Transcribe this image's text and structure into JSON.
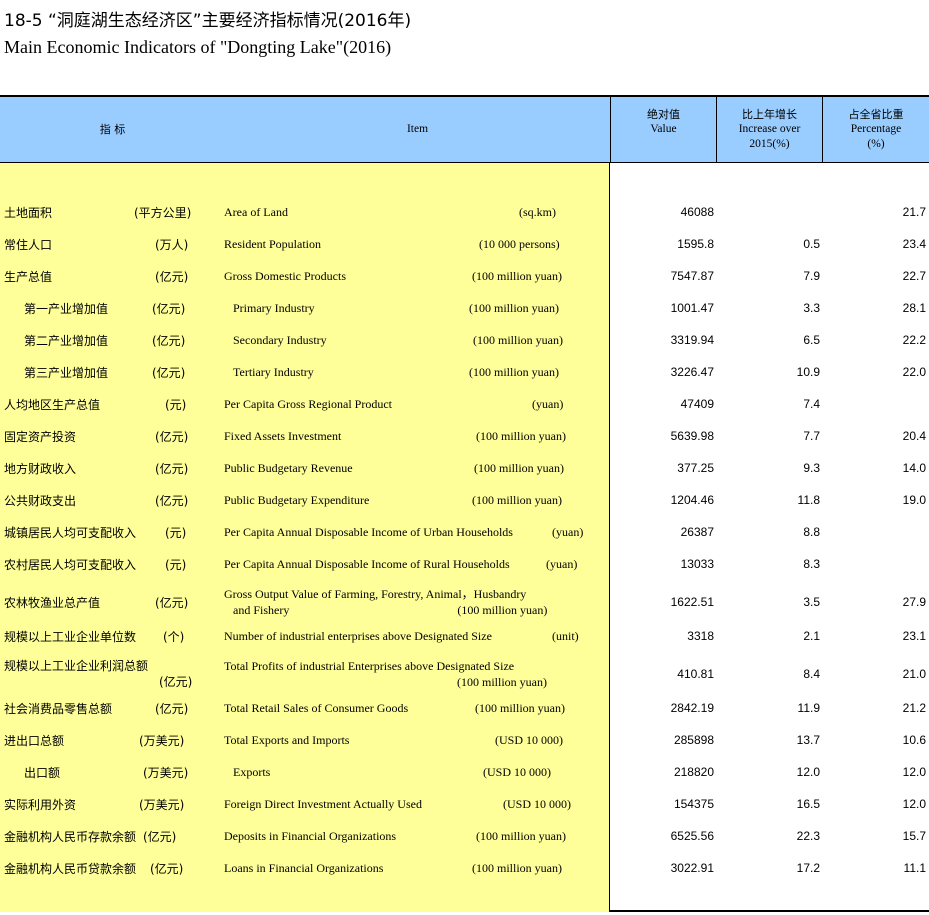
{
  "title": {
    "cn": "18-5  “洞庭湖生态经济区”主要经济指标情况(2016年)",
    "en": "Main Economic Indicators of \"Dongting Lake\"(2016)"
  },
  "header": {
    "indicator_cn": "指  标",
    "item_en": "Item",
    "col_value_cn": "绝对值",
    "col_value_en": "Value",
    "col_growth_cn": "比上年增长",
    "col_growth_en1": "Increase over",
    "col_growth_en2": "2015(%)",
    "col_share_cn": "占全省比重",
    "col_share_en1": "Percentage",
    "col_share_en2": "(%)"
  },
  "rows": [
    {
      "cn": "土地面积",
      "cn_unit": "(平方公里)",
      "en": "Area of Land",
      "en_unit": "(sq.km)",
      "value": "46088",
      "growth": "",
      "share": "21.7"
    },
    {
      "cn": "常住人口",
      "cn_unit": "(万人)",
      "en": "Resident Population",
      "en_unit": "(10 000 persons)",
      "value": "1595.8",
      "growth": "0.5",
      "share": "23.4"
    },
    {
      "cn": "生产总值",
      "cn_unit": "(亿元)",
      "en": "Gross Domestic Products",
      "en_unit": "(100 million yuan)",
      "value": "7547.87",
      "growth": "7.9",
      "share": "22.7"
    },
    {
      "cn": "第一产业增加值",
      "cn_unit": "(亿元)",
      "en": "Primary Industry",
      "en_unit": "(100 million yuan)",
      "value": "1001.47",
      "growth": "3.3",
      "share": "28.1"
    },
    {
      "cn": "第二产业增加值",
      "cn_unit": "(亿元)",
      "en": "Secondary Industry",
      "en_unit": "(100 million yuan)",
      "value": "3319.94",
      "growth": "6.5",
      "share": "22.2"
    },
    {
      "cn": "第三产业增加值",
      "cn_unit": "(亿元)",
      "en": "Tertiary Industry",
      "en_unit": "(100 million yuan)",
      "value": "3226.47",
      "growth": "10.9",
      "share": "22.0"
    },
    {
      "cn": "人均地区生产总值",
      "cn_unit": "(元)",
      "en": "Per  Capita Gross Regional Product",
      "en_unit": "(yuan)",
      "value": "47409",
      "growth": "7.4",
      "share": ""
    },
    {
      "cn": "固定资产投资",
      "cn_unit": "(亿元)",
      "en": "Fixed Assets Investment",
      "en_unit": "(100 million yuan)",
      "value": "5639.98",
      "growth": "7.7",
      "share": "20.4"
    },
    {
      "cn": "地方财政收入",
      "cn_unit": "(亿元)",
      "en": "Public Budgetary Revenue",
      "en_unit": "(100 million yuan)",
      "value": "377.25",
      "growth": "9.3",
      "share": "14.0"
    },
    {
      "cn": "公共财政支出",
      "cn_unit": "(亿元)",
      "en": "Public Budgetary Expenditure",
      "en_unit": "(100 million yuan)",
      "value": "1204.46",
      "growth": "11.8",
      "share": "19.0"
    },
    {
      "cn": "城镇居民人均可支配收入",
      "cn_unit": "(元)",
      "en": "Per Capita Annual Disposable Income of Urban Households",
      "en_unit": "(yuan)",
      "value": "26387",
      "growth": "8.8",
      "share": ""
    },
    {
      "cn": "农村居民人均可支配收入",
      "cn_unit": "(元)",
      "en": "Per Capita Annual Disposable Income of Rural Households",
      "en_unit": "(yuan)",
      "value": "13033",
      "growth": "8.3",
      "share": ""
    },
    {
      "cn": "农林牧渔业总产值",
      "cn_unit": "(亿元)",
      "en": "Gross Output Value of Farming, Forestry, Animal，Husbandry",
      "en2": "and Fishery",
      "en_unit": "(100 million yuan)",
      "value": "1622.51",
      "growth": "3.5",
      "share": "27.9"
    },
    {
      "cn": "规模以上工业企业单位数",
      "cn_unit": "(个)",
      "en": "Number of industrial enterprises above Designated Size",
      "en_unit": "(unit)",
      "value": "3318",
      "growth": "2.1",
      "share": "23.1"
    },
    {
      "cn": "规模以上工业企业利润总额",
      "cn_unit": "(亿元)",
      "en": "Total Profits of industrial Enterprises  above Designated Size",
      "en_unit": "(100 million yuan)",
      "value": "410.81",
      "growth": "8.4",
      "share": "21.0"
    },
    {
      "cn": "社会消费品零售总额",
      "cn_unit": "(亿元)",
      "en": "Total Retail Sales of Consumer Goods",
      "en_unit": "(100 million yuan)",
      "value": "2842.19",
      "growth": "11.9",
      "share": "21.2"
    },
    {
      "cn": "进出口总额",
      "cn_unit": "(万美元)",
      "en": "Total Exports and Imports",
      "en_unit": "(USD 10 000)",
      "value": "285898",
      "growth": "13.7",
      "share": "10.6"
    },
    {
      "cn": "出口额",
      "cn_unit": "(万美元)",
      "en": "Exports",
      "en_unit": "(USD 10 000)",
      "value": "218820",
      "growth": "12.0",
      "share": "12.0"
    },
    {
      "cn": "实际利用外资",
      "cn_unit": "(万美元)",
      "en": "Foreign Direct Investment Actually Used",
      "en_unit": "(USD 10 000)",
      "value": "154375",
      "growth": "16.5",
      "share": "12.0"
    },
    {
      "cn": "金融机构人民币存款余额",
      "cn_unit": "(亿元)",
      "en": "Deposits in Financial Organizations",
      "en_unit": "(100 million yuan)",
      "value": "6525.56",
      "growth": "22.3",
      "share": "15.7"
    },
    {
      "cn": "金融机构人民币贷款余额",
      "cn_unit": "(亿元)",
      "en": "Loans in Financial Organizations",
      "en_unit": "(100 million yuan)",
      "value": "3022.91",
      "growth": "17.2",
      "share": "11.1"
    }
  ]
}
